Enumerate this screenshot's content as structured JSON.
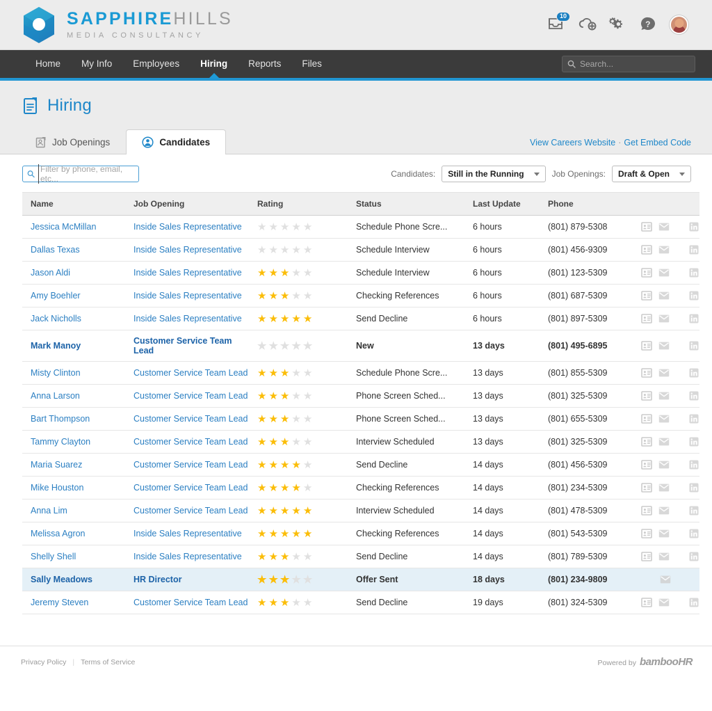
{
  "brand": {
    "name_part1": "SAPPHIRE",
    "name_part2": "HILLS",
    "tagline": "MEDIA CONSULTANCY",
    "accent": "#1a9ad4"
  },
  "topbar": {
    "inbox_badge": "10",
    "icons": [
      "inbox-icon",
      "cloud-upload-icon",
      "gears-icon",
      "help-icon",
      "avatar"
    ]
  },
  "nav": {
    "items": [
      {
        "label": "Home",
        "active": false
      },
      {
        "label": "My Info",
        "active": false
      },
      {
        "label": "Employees",
        "active": false
      },
      {
        "label": "Hiring",
        "active": true
      },
      {
        "label": "Reports",
        "active": false
      },
      {
        "label": "Files",
        "active": false
      }
    ],
    "search_placeholder": "Search...",
    "underline_color": "#2196d3"
  },
  "page": {
    "title": "Hiring"
  },
  "tabs": [
    {
      "label": "Job Openings",
      "active": false,
      "icon": "job-opening-icon"
    },
    {
      "label": "Candidates",
      "active": true,
      "icon": "candidate-icon"
    }
  ],
  "tab_links": {
    "view_careers": "View Careers Website",
    "separator": "·",
    "embed_code": "Get Embed Code"
  },
  "filters": {
    "search_placeholder": "Filter by phone, email, etc...",
    "search_value": "",
    "candidates_label": "Candidates:",
    "candidates_value": "Still in the Running",
    "job_openings_label": "Job Openings:",
    "job_openings_value": "Draft & Open"
  },
  "table": {
    "columns": [
      "Name",
      "Job Opening",
      "Rating",
      "Status",
      "Last Update",
      "Phone"
    ],
    "rows": [
      {
        "name": "Jessica McMillan",
        "job": "Inside Sales Representative",
        "rating": 0,
        "status": "Schedule Phone Scre...",
        "update": "6 hours",
        "phone": "(801) 879-5308",
        "bold": false,
        "highlight": false,
        "actions": [
          "resume-icon",
          "email-icon",
          "linkedin-icon"
        ]
      },
      {
        "name": "Dallas Texas",
        "job": "Inside Sales Representative",
        "rating": 0,
        "status": "Schedule Interview",
        "update": "6 hours",
        "phone": "(801) 456-9309",
        "bold": false,
        "highlight": false,
        "actions": [
          "resume-icon",
          "email-icon",
          "linkedin-icon"
        ]
      },
      {
        "name": "Jason Aldi",
        "job": "Inside Sales Representative",
        "rating": 3,
        "status": "Schedule Interview",
        "update": "6 hours",
        "phone": "(801) 123-5309",
        "bold": false,
        "highlight": false,
        "actions": [
          "resume-icon",
          "email-icon",
          "linkedin-icon"
        ]
      },
      {
        "name": "Amy Boehler",
        "job": "Inside Sales Representative",
        "rating": 3,
        "status": "Checking References",
        "update": "6 hours",
        "phone": "(801) 687-5309",
        "bold": false,
        "highlight": false,
        "actions": [
          "resume-icon",
          "email-icon",
          "linkedin-icon"
        ]
      },
      {
        "name": "Jack Nicholls",
        "job": "Inside Sales Representative",
        "rating": 5,
        "status": "Send Decline",
        "update": "6 hours",
        "phone": "(801) 897-5309",
        "bold": false,
        "highlight": false,
        "actions": [
          "resume-icon",
          "email-icon",
          "linkedin-icon"
        ]
      },
      {
        "name": "Mark Manoy",
        "job": "Customer Service Team Lead",
        "rating": 0,
        "status": "New",
        "update": "13 days",
        "phone": "(801) 495-6895",
        "bold": true,
        "highlight": false,
        "actions": [
          "resume-icon",
          "email-icon",
          "linkedin-icon"
        ]
      },
      {
        "name": "Misty Clinton",
        "job": "Customer Service Team Lead",
        "rating": 3,
        "status": "Schedule Phone Scre...",
        "update": "13 days",
        "phone": "(801) 855-5309",
        "bold": false,
        "highlight": false,
        "actions": [
          "resume-icon",
          "email-icon",
          "linkedin-icon"
        ]
      },
      {
        "name": "Anna Larson",
        "job": "Customer Service Team Lead",
        "rating": 3,
        "status": "Phone Screen Sched...",
        "update": "13 days",
        "phone": "(801) 325-5309",
        "bold": false,
        "highlight": false,
        "actions": [
          "resume-icon",
          "email-icon",
          "linkedin-icon"
        ]
      },
      {
        "name": "Bart Thompson",
        "job": "Customer Service Team Lead",
        "rating": 3,
        "status": "Phone Screen Sched...",
        "update": "13 days",
        "phone": "(801) 655-5309",
        "bold": false,
        "highlight": false,
        "actions": [
          "resume-icon",
          "email-icon",
          "linkedin-icon"
        ]
      },
      {
        "name": "Tammy Clayton",
        "job": "Customer Service Team Lead",
        "rating": 3,
        "status": "Interview Scheduled",
        "update": "13 days",
        "phone": "(801) 325-5309",
        "bold": false,
        "highlight": false,
        "actions": [
          "resume-icon",
          "email-icon",
          "linkedin-icon"
        ]
      },
      {
        "name": "Maria Suarez",
        "job": "Customer Service Team Lead",
        "rating": 4,
        "status": "Send Decline",
        "update": "14 days",
        "phone": "(801) 456-5309",
        "bold": false,
        "highlight": false,
        "actions": [
          "resume-icon",
          "email-icon",
          "linkedin-icon"
        ]
      },
      {
        "name": "Mike Houston",
        "job": "Customer Service Team Lead",
        "rating": 4,
        "status": "Checking References",
        "update": "14 days",
        "phone": "(801) 234-5309",
        "bold": false,
        "highlight": false,
        "actions": [
          "resume-icon",
          "email-icon",
          "linkedin-icon"
        ]
      },
      {
        "name": "Anna Lim",
        "job": "Customer Service Team Lead",
        "rating": 5,
        "status": "Interview Scheduled",
        "update": "14 days",
        "phone": "(801) 478-5309",
        "bold": false,
        "highlight": false,
        "actions": [
          "resume-icon",
          "email-icon",
          "linkedin-icon"
        ]
      },
      {
        "name": "Melissa Agron",
        "job": "Inside Sales Representative",
        "rating": 5,
        "status": "Checking References",
        "update": "14 days",
        "phone": "(801) 543-5309",
        "bold": false,
        "highlight": false,
        "actions": [
          "resume-icon",
          "email-icon",
          "linkedin-icon"
        ]
      },
      {
        "name": "Shelly Shell",
        "job": "Inside Sales Representative",
        "rating": 3,
        "status": "Send Decline",
        "update": "14 days",
        "phone": "(801) 789-5309",
        "bold": false,
        "highlight": false,
        "actions": [
          "resume-icon",
          "email-icon",
          "linkedin-icon"
        ]
      },
      {
        "name": "Sally Meadows",
        "job": "HR Director",
        "rating": 3,
        "status": "Offer Sent",
        "update": "18 days",
        "phone": "(801) 234-9809",
        "bold": true,
        "highlight": true,
        "actions": [
          "email-icon"
        ]
      },
      {
        "name": "Jeremy Steven",
        "job": "Customer Service Team Lead",
        "rating": 3,
        "status": "Send Decline",
        "update": "19 days",
        "phone": "(801) 324-5309",
        "bold": false,
        "highlight": false,
        "actions": [
          "resume-icon",
          "email-icon",
          "linkedin-icon"
        ]
      }
    ]
  },
  "footer": {
    "privacy": "Privacy Policy",
    "terms": "Terms of Service",
    "powered_by": "Powered by",
    "vendor": "bambooHR"
  }
}
